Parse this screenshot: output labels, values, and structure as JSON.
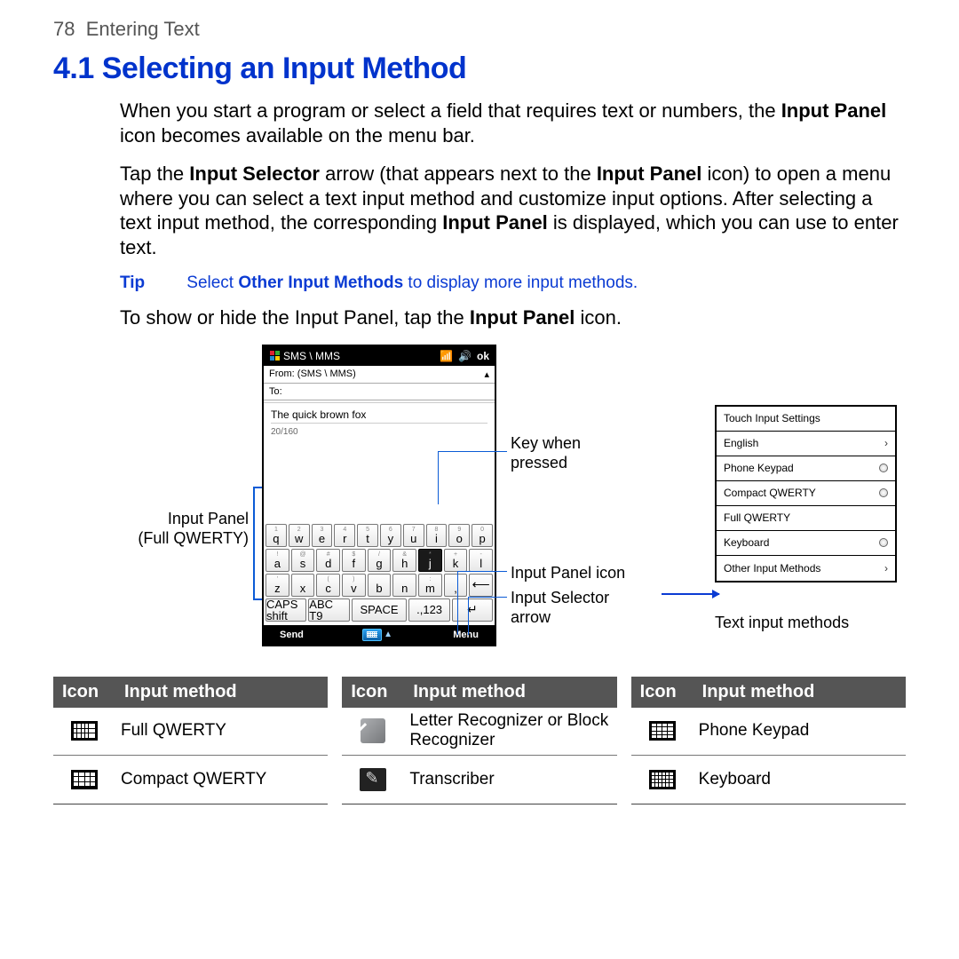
{
  "page": {
    "number": "78",
    "chapter": "Entering Text"
  },
  "section": {
    "number": "4.1",
    "title": "Selecting an Input Method"
  },
  "paragraphs": {
    "p1a": "When you start a program or select a field that requires text or numbers, the ",
    "p1b": "Input Panel",
    "p1c": " icon becomes available on the menu bar.",
    "p2a": "Tap the ",
    "p2b": "Input Selector",
    "p2c": " arrow (that appears next to the ",
    "p2d": "Input Panel",
    "p2e": " icon) to open a menu where you can select a text input method and customize input options. After selecting a text input method, the corresponding ",
    "p2f": "Input Panel",
    "p2g": " is displayed, which you can use to enter text.",
    "tip_label": "Tip",
    "tip_a": "Select ",
    "tip_b": "Other Input Methods",
    "tip_c": " to display more input methods.",
    "p3a": "To show or hide the Input Panel, tap the ",
    "p3b": "Input Panel",
    "p3c": " icon."
  },
  "phone": {
    "title": "SMS \\ MMS",
    "ok": "ok",
    "from_label": "From:",
    "from_value": "(SMS \\ MMS)",
    "to_label": "To:",
    "message": "The quick brown fox",
    "counter": "20/160",
    "soft_left": "Send",
    "soft_right": "Menu",
    "rows": {
      "r1_mini": [
        "1",
        "2",
        "3",
        "4",
        "5",
        "6",
        "7",
        "8",
        "9",
        "0"
      ],
      "r1": [
        "q",
        "w",
        "e",
        "r",
        "t",
        "y",
        "u",
        "i",
        "o",
        "p"
      ],
      "r2_mini": [
        "!",
        "@",
        "#",
        "$",
        "/",
        "&",
        "*",
        "+",
        "-"
      ],
      "r2": [
        "a",
        "s",
        "d",
        "f",
        "g",
        "h",
        "j",
        "k",
        "l"
      ],
      "r3_mini": [
        "'",
        "",
        "(",
        ")",
        "",
        "",
        ":"
      ],
      "r3": [
        "z",
        "x",
        "c",
        "v",
        "b",
        "n",
        "m",
        ","
      ],
      "r4": [
        "CAPS shift",
        "ABC T9",
        "SPACE",
        ".,123"
      ]
    }
  },
  "callouts": {
    "left1": "Input Panel",
    "left2": "(Full QWERTY)",
    "r1a": "Key when",
    "r1b": "pressed",
    "r2": "Input Panel icon",
    "r3a": "Input Selector",
    "r3b": "arrow",
    "menu_caption": "Text input methods"
  },
  "popup": {
    "items": [
      "Touch Input Settings",
      "English",
      "Phone Keypad",
      "Compact QWERTY",
      "Full QWERTY",
      "Keyboard",
      "Other Input Methods"
    ]
  },
  "table": {
    "head_icon": "Icon",
    "head_method": "Input method",
    "col1": [
      "Full QWERTY",
      "Compact QWERTY"
    ],
    "col2": [
      "Letter Recognizer or Block Recognizer",
      "Transcriber"
    ],
    "col3": [
      "Phone Keypad",
      "Keyboard"
    ]
  }
}
